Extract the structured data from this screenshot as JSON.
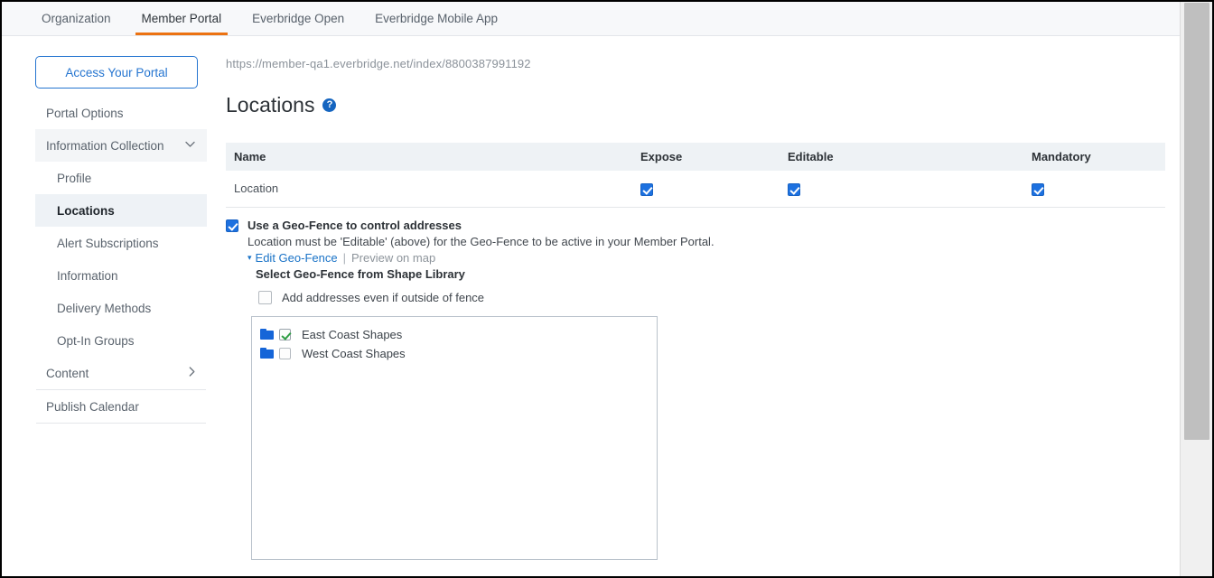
{
  "tabs": [
    {
      "label": "Organization",
      "active": false
    },
    {
      "label": "Member Portal",
      "active": true
    },
    {
      "label": "Everbridge Open",
      "active": false
    },
    {
      "label": "Everbridge Mobile App",
      "active": false
    }
  ],
  "sidebar": {
    "portal_button": "Access Your Portal",
    "items": [
      {
        "label": "Portal Options",
        "type": "top",
        "chevron": ""
      },
      {
        "label": "Information Collection",
        "type": "group",
        "chevron": "⌄"
      },
      {
        "label": "Profile",
        "type": "sub"
      },
      {
        "label": "Locations",
        "type": "sub-active"
      },
      {
        "label": "Alert Subscriptions",
        "type": "sub"
      },
      {
        "label": "Information",
        "type": "sub"
      },
      {
        "label": "Delivery Methods",
        "type": "sub"
      },
      {
        "label": "Opt-In Groups",
        "type": "sub"
      },
      {
        "label": "Content",
        "type": "top",
        "chevron": "›"
      },
      {
        "label": "Publish Calendar",
        "type": "top",
        "chevron": ""
      }
    ]
  },
  "main": {
    "url": "https://member-qa1.everbridge.net/index/8800387991192",
    "title": "Locations",
    "help_icon_glyph": "?",
    "table": {
      "columns": [
        "Name",
        "Expose",
        "Editable",
        "Mandatory"
      ],
      "rows": [
        {
          "name": "Location",
          "expose": true,
          "editable": true,
          "mandatory": true
        }
      ]
    },
    "geofence": {
      "use_geofence_checked": true,
      "use_geofence_label": "Use a Geo-Fence to control addresses",
      "note": "Location must be 'Editable' (above) for the Geo-Fence to be active in your Member Portal.",
      "caret_glyph": "▾",
      "edit_link": "Edit Geo-Fence",
      "separator": "|",
      "preview_link": "Preview on map",
      "select_label": "Select Geo-Fence from Shape Library",
      "outside_checked": false,
      "outside_label": "Add addresses even if outside of fence",
      "shape_tree": [
        {
          "label": "East Coast Shapes",
          "checked": true,
          "icon": "folder-icon"
        },
        {
          "label": "West Coast Shapes",
          "checked": false,
          "icon": "folder-icon"
        }
      ]
    }
  },
  "colors": {
    "accent_orange": "#ec7211",
    "link_blue": "#1a73c7",
    "checkbox_blue": "#1d71e0",
    "check_green": "#2e9e43",
    "header_bg": "#eef2f5",
    "active_nav_bg": "#eef2f6"
  }
}
